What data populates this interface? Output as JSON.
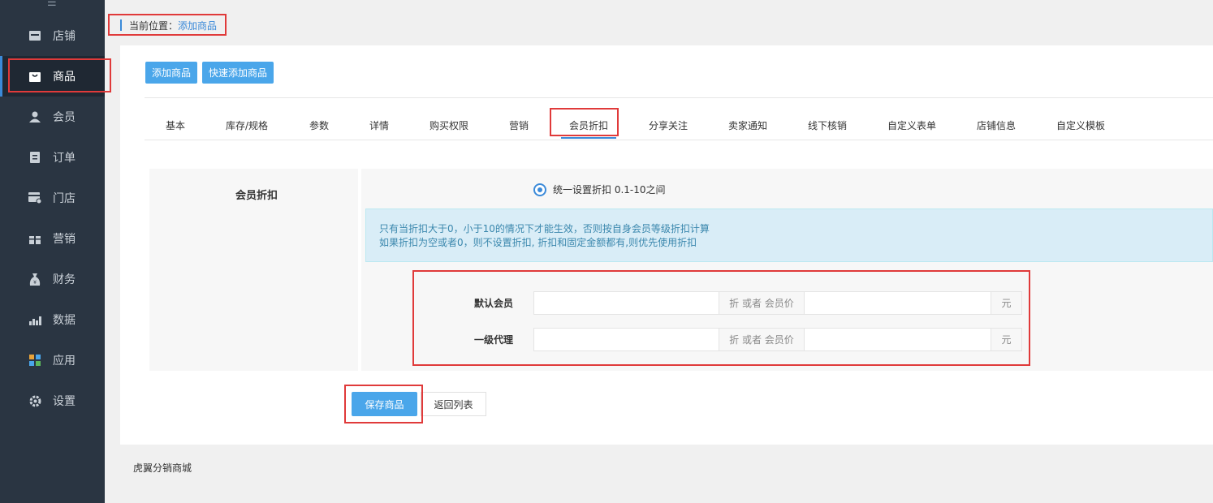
{
  "sidebar": {
    "toggle_icon": "menu-toggle-icon",
    "items": [
      {
        "label": "店铺",
        "icon": "store-icon"
      },
      {
        "label": "商品",
        "icon": "bag-icon",
        "active": true
      },
      {
        "label": "会员",
        "icon": "user-icon"
      },
      {
        "label": "订单",
        "icon": "order-icon"
      },
      {
        "label": "门店",
        "icon": "shop-icon"
      },
      {
        "label": "营销",
        "icon": "gift-icon"
      },
      {
        "label": "财务",
        "icon": "money-bag-icon"
      },
      {
        "label": "数据",
        "icon": "chart-icon"
      },
      {
        "label": "应用",
        "icon": "apps-icon"
      },
      {
        "label": "设置",
        "icon": "gear-icon"
      }
    ]
  },
  "breadcrumb": {
    "prefix": "当前位置：",
    "current": "添加商品"
  },
  "toolbar": {
    "add_label": "添加商品",
    "quick_add_label": "快速添加商品"
  },
  "tabs": [
    "基本",
    "库存/规格",
    "参数",
    "详情",
    "购买权限",
    "营销",
    "会员折扣",
    "分享关注",
    "卖家通知",
    "线下核销",
    "自定义表单",
    "店铺信息",
    "自定义模板"
  ],
  "active_tab": "会员折扣",
  "form": {
    "section_label": "会员折扣",
    "radio_label": "统一设置折扣 0.1-10之间",
    "notice_line1": "只有当折扣大于0，小于10的情况下才能生效，否则按自身会员等级折扣计算",
    "notice_line2": "如果折扣为空或者0，则不设置折扣, 折扣和固定金额都有,则优先使用折扣",
    "levels": [
      {
        "name": "默认会员",
        "discount_value": "",
        "price_value": ""
      },
      {
        "name": "一级代理",
        "discount_value": "",
        "price_value": ""
      }
    ],
    "discount_addon": "折 或者 会员价",
    "price_addon": "元"
  },
  "actions": {
    "save_label": "保存商品",
    "back_label": "返回列表"
  },
  "footer": {
    "text": "虎翼分销商城"
  },
  "colors": {
    "sidebar_bg": "#2a3542",
    "accent": "#4aa6ea",
    "highlight": "#e03a3a"
  }
}
